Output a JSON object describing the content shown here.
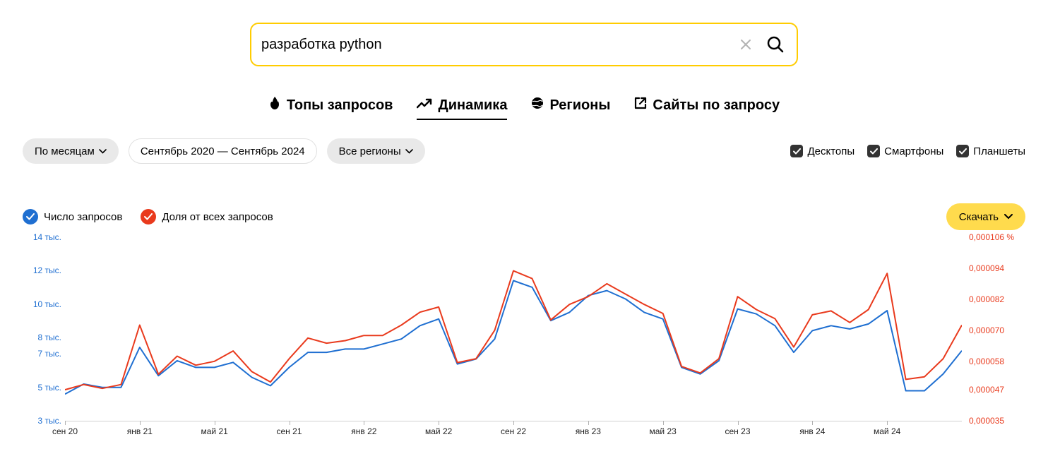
{
  "search": {
    "value": "разработка python"
  },
  "tabs": {
    "tops": "Топы запросов",
    "dynamics": "Динамика",
    "regions": "Регионы",
    "sites": "Сайты по запросу"
  },
  "filters": {
    "period": "По месяцам",
    "date_range": "Сентябрь 2020 — Сентябрь 2024",
    "region": "Все регионы",
    "devices": {
      "desktop": "Десктопы",
      "smartphone": "Смартфоны",
      "tablet": "Планшеты"
    }
  },
  "legend": {
    "series1": "Число запросов",
    "series2": "Доля от всех запросов",
    "download": "Скачать"
  },
  "colors": {
    "blue": "#1f6fd1",
    "red": "#e93a1d",
    "yellow": "#ffdb4d"
  },
  "chart_data": {
    "type": "line",
    "x": [
      "сен 20",
      "окт 20",
      "ноя 20",
      "дек 20",
      "янв 21",
      "фев 21",
      "мар 21",
      "апр 21",
      "май 21",
      "июн 21",
      "июл 21",
      "авг 21",
      "сен 21",
      "окт 21",
      "ноя 21",
      "дек 21",
      "янв 22",
      "фев 22",
      "мар 22",
      "апр 22",
      "май 22",
      "июн 22",
      "июл 22",
      "авг 22",
      "сен 22",
      "окт 22",
      "ноя 22",
      "дек 22",
      "янв 23",
      "фев 23",
      "мар 23",
      "апр 23",
      "май 23",
      "июн 23",
      "июл 23",
      "авг 23",
      "сен 23",
      "окт 23",
      "ноя 23",
      "дек 23",
      "янв 24",
      "фев 24",
      "мар 24",
      "апр 24",
      "май 24",
      "июн 24",
      "июл 24",
      "авг 24",
      "сен 24"
    ],
    "x_ticks_shown": [
      "сен 20",
      "янв 21",
      "май 21",
      "сен 21",
      "янв 22",
      "май 22",
      "сен 22",
      "янв 23",
      "май 23",
      "сен 23",
      "янв 24",
      "май 24"
    ],
    "series": [
      {
        "name": "Число запросов",
        "axis": "left",
        "color": "#1f6fd1",
        "values": [
          4600,
          5200,
          5000,
          5000,
          7400,
          5700,
          6600,
          6200,
          6200,
          6500,
          5600,
          5100,
          6200,
          7100,
          7100,
          7300,
          7300,
          7600,
          7900,
          8700,
          9100,
          6400,
          6700,
          7900,
          11400,
          11000,
          9000,
          9500,
          10500,
          10800,
          10300,
          9500,
          9100,
          6200,
          5800,
          6600,
          9700,
          9400,
          8700,
          7100,
          8400,
          8700,
          8500,
          8800,
          9600,
          4800,
          4800,
          5800,
          7200
        ]
      },
      {
        "name": "Доля от всех запросов",
        "axis": "right",
        "color": "#e93a1d",
        "values": [
          4.7e-05,
          4.9e-05,
          4.75e-05,
          4.9e-05,
          7.2e-05,
          5.3e-05,
          6e-05,
          5.65e-05,
          5.8e-05,
          6.2e-05,
          5.4e-05,
          5e-05,
          5.9e-05,
          6.7e-05,
          6.5e-05,
          6.6e-05,
          6.8e-05,
          6.8e-05,
          7.2e-05,
          7.7e-05,
          7.9e-05,
          5.75e-05,
          5.9e-05,
          7e-05,
          9.3e-05,
          9e-05,
          7.4e-05,
          8e-05,
          8.3e-05,
          8.8e-05,
          8.4e-05,
          8e-05,
          7.65e-05,
          5.6e-05,
          5.35e-05,
          5.9e-05,
          8.3e-05,
          7.8e-05,
          7.45e-05,
          6.35e-05,
          7.6e-05,
          7.75e-05,
          7.3e-05,
          7.8e-05,
          9.2e-05,
          5.1e-05,
          5.2e-05,
          5.9e-05,
          7.2e-05
        ]
      }
    ],
    "y_left": {
      "ticks": [
        14000,
        12000,
        10000,
        8000,
        7000,
        5000,
        3000
      ],
      "labels": [
        "14 тыс.",
        "12 тыс.",
        "10 тыс.",
        "8 тыс.",
        "7 тыс.",
        "5 тыс.",
        "3 тыс."
      ],
      "range": [
        3000,
        14000
      ]
    },
    "y_right": {
      "ticks": [
        0.000106,
        9.4e-05,
        8.2e-05,
        7e-05,
        5.8e-05,
        4.7e-05,
        3.5e-05
      ],
      "labels": [
        "0,000106 %",
        "0,000094",
        "0,000082",
        "0,000070",
        "0,000058",
        "0,000047",
        "0,000035"
      ],
      "range": [
        3.5e-05,
        0.000106
      ]
    }
  }
}
